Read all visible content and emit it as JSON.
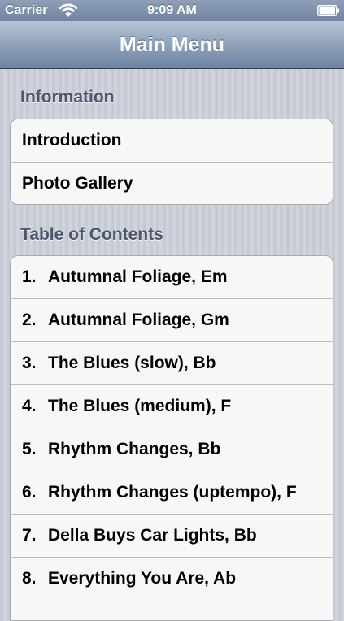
{
  "status_bar": {
    "carrier": "Carrier",
    "time": "9:09 AM",
    "icons": [
      "wifi-icon",
      "battery-icon"
    ]
  },
  "nav_bar": {
    "title": "Main Menu"
  },
  "sections": [
    {
      "header": "Information",
      "rows": [
        {
          "label": "Introduction"
        },
        {
          "label": "Photo Gallery"
        }
      ]
    },
    {
      "header": "Table of Contents",
      "rows": [
        {
          "number": "1.",
          "label": "Autumnal Foliage, Em"
        },
        {
          "number": "2.",
          "label": "Autumnal Foliage, Gm"
        },
        {
          "number": "3.",
          "label": "The Blues (slow), Bb"
        },
        {
          "number": "4.",
          "label": "The Blues (medium), F"
        },
        {
          "number": "5.",
          "label": "Rhythm Changes, Bb"
        },
        {
          "number": "6.",
          "label": "Rhythm Changes (uptempo), F"
        },
        {
          "number": "7.",
          "label": "Della Buys Car Lights, Bb"
        },
        {
          "number": "8.",
          "label": "Everything You Are, Ab"
        }
      ]
    }
  ],
  "colors": {
    "nav_bar": "#8ea1ba",
    "section_header": "#4c566c",
    "cell_background": "#f7f7f7",
    "table_background": "#c8ccd6"
  }
}
